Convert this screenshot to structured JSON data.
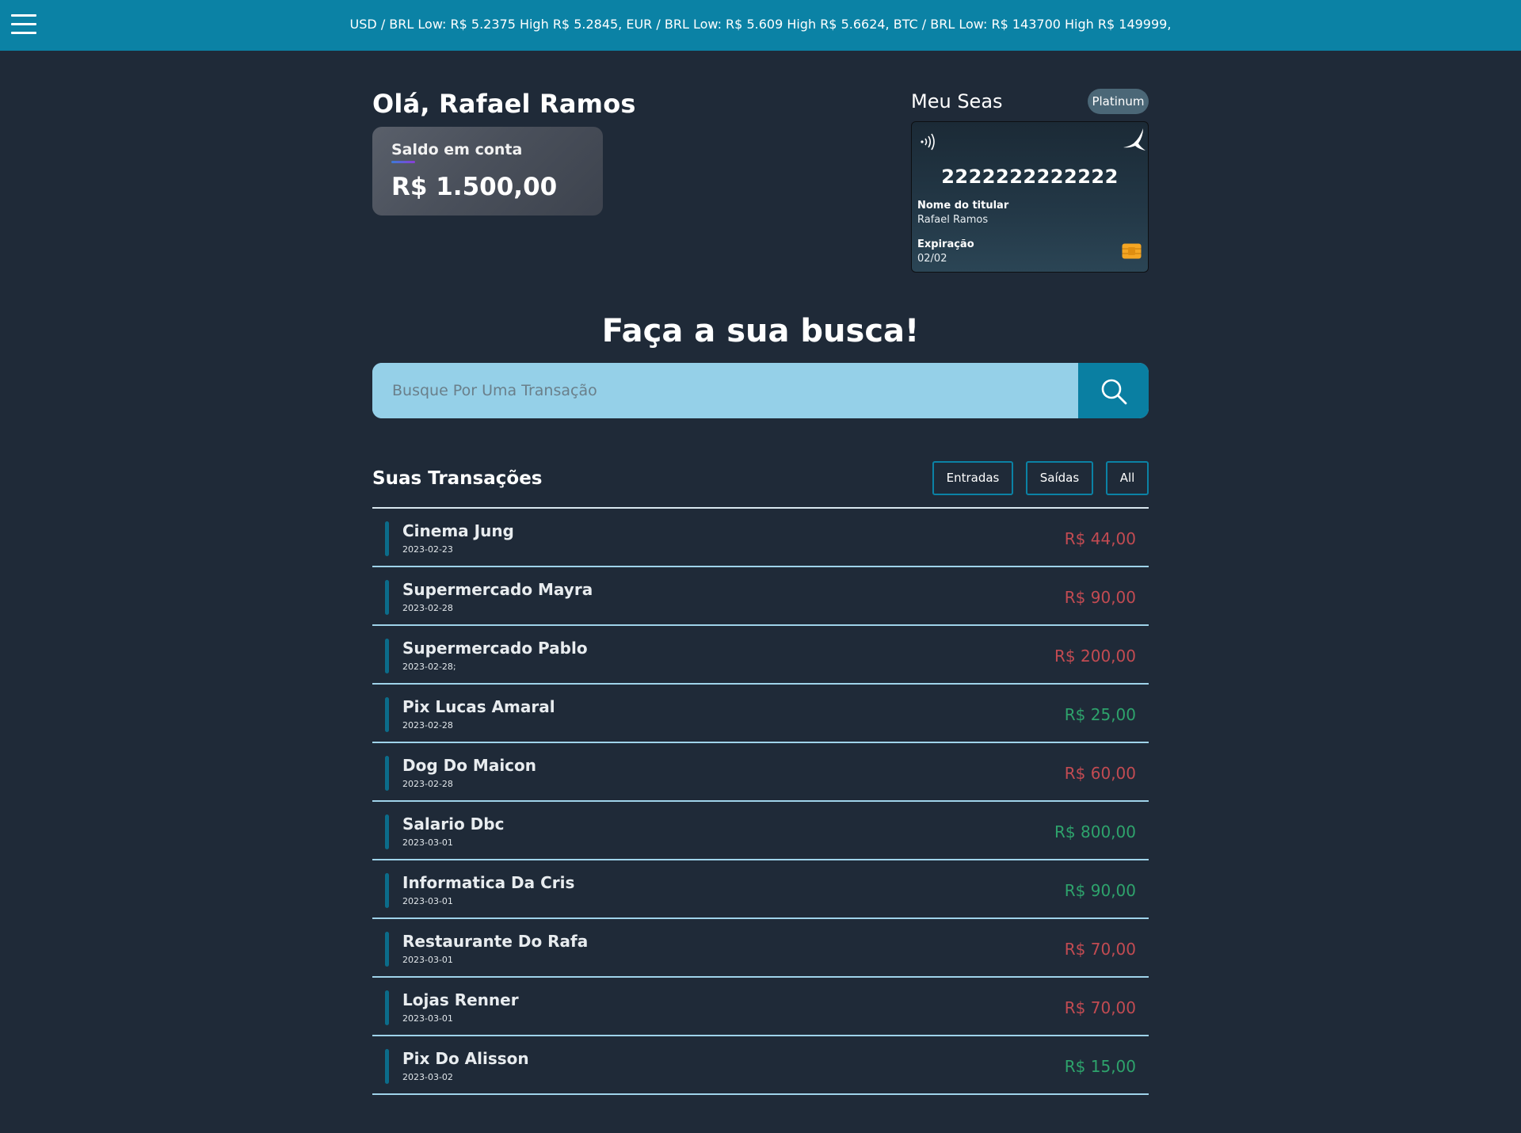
{
  "topbar": {
    "ticker": "USD / BRL Low: R$ 5.2375 High R$ 5.2845, EUR / BRL Low: R$ 5.609 High R$ 5.6624, BTC / BRL Low: R$ 143700 High R$ 149999,",
    "menu_icon": "hamburger-menu-icon",
    "color": "#0b82a5"
  },
  "greeting": "Olá, Rafael Ramos",
  "balance": {
    "label": "Saldo em conta",
    "value": "R$ 1.500,00"
  },
  "card": {
    "title": "Meu Seas",
    "tier": "Platinum",
    "number": "2222222222222",
    "holder_label": "Nome do titular",
    "holder_name": "Rafael Ramos",
    "expiration_label": "Expiração",
    "expiration": "02/02",
    "icons": [
      "nfc-icon",
      "bird-logo-icon",
      "chip-icon"
    ]
  },
  "search": {
    "title": "Faça a sua busca!",
    "placeholder": "Busque Por Uma Transação",
    "value": "",
    "icon": "search-icon"
  },
  "transactions": {
    "title": "Suas Transações",
    "filters": [
      "Entradas",
      "Saídas",
      "All"
    ],
    "items": [
      {
        "name": "Cinema Jung",
        "date": "2023-02-23",
        "amount": "R$ 44,00",
        "type": "out"
      },
      {
        "name": "Supermercado Mayra",
        "date": "2023-02-28",
        "amount": "R$ 90,00",
        "type": "out"
      },
      {
        "name": "Supermercado Pablo",
        "date": "2023-02-28;",
        "amount": "R$ 200,00",
        "type": "out"
      },
      {
        "name": "Pix Lucas Amaral",
        "date": "2023-02-28",
        "amount": "R$ 25,00",
        "type": "in"
      },
      {
        "name": "Dog Do Maicon",
        "date": "2023-02-28",
        "amount": "R$ 60,00",
        "type": "out"
      },
      {
        "name": "Salario Dbc",
        "date": "2023-03-01",
        "amount": "R$ 800,00",
        "type": "in"
      },
      {
        "name": "Informatica Da Cris",
        "date": "2023-03-01",
        "amount": "R$ 90,00",
        "type": "in"
      },
      {
        "name": "Restaurante Do Rafa",
        "date": "2023-03-01",
        "amount": "R$ 70,00",
        "type": "out"
      },
      {
        "name": "Lojas Renner",
        "date": "2023-03-01",
        "amount": "R$ 70,00",
        "type": "out"
      },
      {
        "name": "Pix Do Alisson",
        "date": "2023-03-02",
        "amount": "R$ 15,00",
        "type": "in"
      }
    ]
  },
  "colors": {
    "background": "#1f2a38",
    "accent": "#0b82a5",
    "out": "#c24b52",
    "in": "#2ea36c"
  }
}
